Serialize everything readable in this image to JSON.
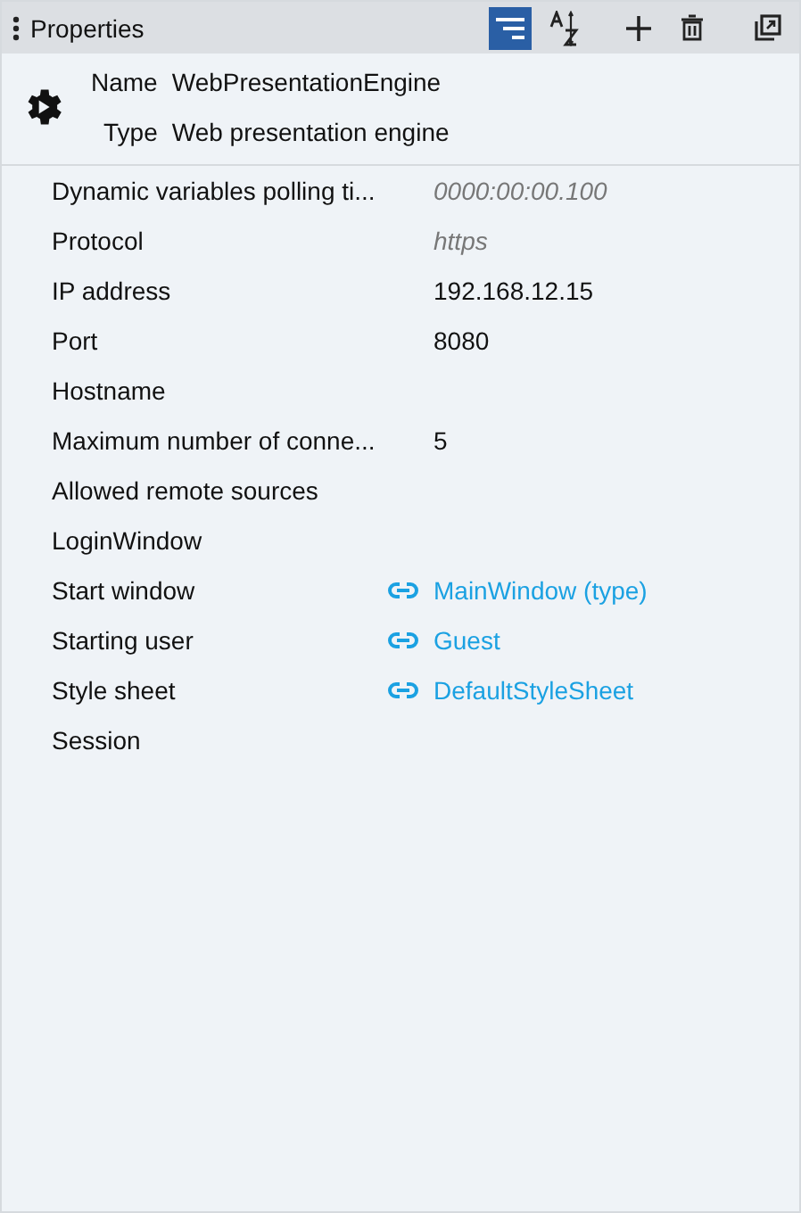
{
  "panel": {
    "title": "Properties"
  },
  "toolbar": [
    {
      "kind": "categorized",
      "selected": true
    },
    {
      "kind": "alphabetical",
      "selected": false
    },
    {
      "kind": "add"
    },
    {
      "kind": "delete"
    },
    {
      "kind": "detach"
    }
  ],
  "header": {
    "name_label": "Name",
    "name": "WebPresentationEngine",
    "type_label": "Type",
    "type": "Web presentation engine"
  },
  "properties": [
    {
      "label": "Dynamic variables polling ti...",
      "kind": "placeholder",
      "value": "0000:00:00.100"
    },
    {
      "label": "Protocol",
      "kind": "placeholder",
      "value": "https"
    },
    {
      "label": "IP address",
      "kind": "text",
      "value": "192.168.12.15"
    },
    {
      "label": "Port",
      "kind": "text",
      "value": "8080"
    },
    {
      "label": "Hostname",
      "kind": "empty"
    },
    {
      "label": "Maximum number of conne...",
      "kind": "text",
      "value": "5"
    },
    {
      "label": "Allowed remote sources",
      "kind": "empty"
    },
    {
      "label": "LoginWindow",
      "kind": "empty"
    },
    {
      "label": "Start window",
      "kind": "link",
      "value": "MainWindow (type)"
    },
    {
      "label": "Starting user",
      "kind": "link",
      "value": "Guest"
    },
    {
      "label": "Style sheet",
      "kind": "link",
      "value": "DefaultStyleSheet"
    },
    {
      "label": "Session",
      "kind": "empty"
    }
  ]
}
